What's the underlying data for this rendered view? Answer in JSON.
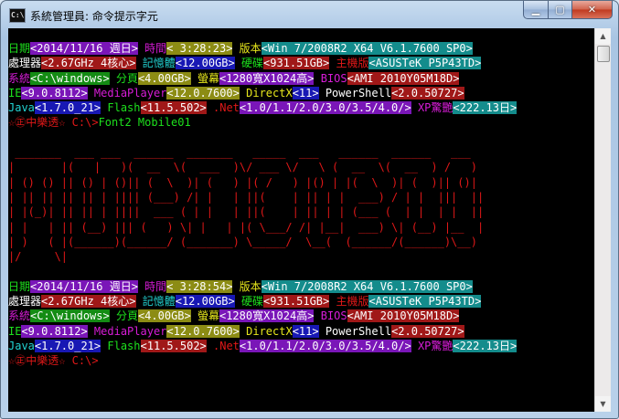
{
  "window": {
    "icon_text": "C:\\",
    "title": "系統管理員: 命令提示字元",
    "buttons": {
      "minimize": "▁",
      "maximize": "▢",
      "close": "✕"
    }
  },
  "colors": {
    "gray": "#c0c0c0",
    "white": "#ffffff",
    "green": "#1de01d",
    "cyan": "#22d3d3",
    "magenta": "#d81cd8",
    "red": "#e01818",
    "yellow": "#e6e61c",
    "bg_purple": "#7a16b8",
    "bg_olive": "#8c8c14",
    "bg_darkred": "#a01818",
    "bg_blue": "#1818b4",
    "bg_teal": "#148c8c",
    "bg_gray": "#808080",
    "bg_darkgreen": "#148c14"
  },
  "info_block_1": [
    [
      {
        "t": "日期",
        "fg": "green"
      },
      {
        "t": "<2014/11/16 週日>",
        "fg": "white",
        "bg": "bg_purple"
      },
      {
        "t": " 時間",
        "fg": "magenta"
      },
      {
        "t": "< 3:28:23>",
        "fg": "white",
        "bg": "bg_olive"
      },
      {
        "t": " 版本",
        "fg": "yellow"
      },
      {
        "t": "<Win 7/2008R2 X64 V6.1.7600 SP0>",
        "fg": "white",
        "bg": "bg_teal"
      }
    ],
    [
      {
        "t": "處理器",
        "fg": "white"
      },
      {
        "t": "<2.67GHz 4核心>",
        "fg": "white",
        "bg": "bg_darkred"
      },
      {
        "t": " 記憶體",
        "fg": "cyan"
      },
      {
        "t": "<12.00GB>",
        "fg": "white",
        "bg": "bg_blue"
      },
      {
        "t": " 硬碟",
        "fg": "green"
      },
      {
        "t": "<931.51GB>",
        "fg": "white",
        "bg": "bg_darkred"
      },
      {
        "t": " 主機版",
        "fg": "red"
      },
      {
        "t": "<ASUSTeK P5P43TD>",
        "fg": "white",
        "bg": "bg_teal"
      }
    ],
    [
      {
        "t": "系統",
        "fg": "magenta"
      },
      {
        "t": "<C:\\windows>",
        "fg": "white",
        "bg": "bg_darkgreen"
      },
      {
        "t": " 分頁",
        "fg": "green"
      },
      {
        "t": "<4.00GB>",
        "fg": "white",
        "bg": "bg_olive"
      },
      {
        "t": " 螢幕",
        "fg": "yellow"
      },
      {
        "t": "<1280寬X1024高>",
        "fg": "white",
        "bg": "bg_purple"
      },
      {
        "t": " BIOS",
        "fg": "magenta"
      },
      {
        "t": "<AMI 2010Y05M18D>",
        "fg": "white",
        "bg": "bg_darkred"
      }
    ],
    [
      {
        "t": "IE",
        "fg": "green"
      },
      {
        "t": "<9.0.8112>",
        "fg": "white",
        "bg": "bg_purple"
      },
      {
        "t": " MediaPlayer",
        "fg": "magenta"
      },
      {
        "t": "<12.0.7600>",
        "fg": "white",
        "bg": "bg_olive"
      },
      {
        "t": " DirectX",
        "fg": "yellow"
      },
      {
        "t": "<11>",
        "fg": "white",
        "bg": "bg_blue"
      },
      {
        "t": " PowerShell",
        "fg": "white"
      },
      {
        "t": "<2.0.50727>",
        "fg": "white",
        "bg": "bg_darkred"
      }
    ],
    [
      {
        "t": "Java",
        "fg": "cyan"
      },
      {
        "t": "<1.7.0_21>",
        "fg": "white",
        "bg": "bg_blue"
      },
      {
        "t": " Flash",
        "fg": "green"
      },
      {
        "t": "<11.5.502>",
        "fg": "white",
        "bg": "bg_darkred"
      },
      {
        "t": " .Net",
        "fg": "red"
      },
      {
        "t": "<1.0/1.1/2.0/3.0/3.5/4.0/>",
        "fg": "white",
        "bg": "bg_purple"
      },
      {
        "t": " XP驚艷",
        "fg": "magenta"
      },
      {
        "t": "<222.13日>",
        "fg": "white",
        "bg": "bg_teal"
      }
    ]
  ],
  "prompt_1": {
    "prefix": "☆㊣中樂透☆ C:\\>",
    "command": "Font2 Mobile01"
  },
  "ascii_art": [
    "",
    " _______  ___ ___  ______  _______   _____  ___   ______  ______   ___",
    "|       |(   |   )(  __  \\(  ___  )\\/ ___ \\/   \\ (  __  \\(  __  ) /   )",
    "| () () || () | ()|| (  \\  )| (   ) |( /   ) |() | |(  \\  )| (  )|| ()|",
    "| || || || || | |||| (___) /| |   | ||(    | || | |  ___) / | |  |||  ||",
    "| |(_)| || || | ||||  ___ ( | |   | ||(    | || | | (___ (  | |  | |  ||",
    "| |   | || (__) ||| (   ) \\| |   | |( \\___/ /| |__|  ___) \\| (__) |__  |",
    "| )   ( |(______)(______/ (_______) \\_____/  \\__(  (______/(______)\\__)",
    "|/     \\|                                          "
  ],
  "info_block_2": [
    [
      {
        "t": "日期",
        "fg": "green"
      },
      {
        "t": "<2014/11/16 週日>",
        "fg": "white",
        "bg": "bg_purple"
      },
      {
        "t": " 時間",
        "fg": "magenta"
      },
      {
        "t": "< 3:28:54>",
        "fg": "white",
        "bg": "bg_olive"
      },
      {
        "t": " 版本",
        "fg": "yellow"
      },
      {
        "t": "<Win 7/2008R2 X64 V6.1.7600 SP0>",
        "fg": "white",
        "bg": "bg_teal"
      }
    ],
    [
      {
        "t": "處理器",
        "fg": "white"
      },
      {
        "t": "<2.67GHz 4核心>",
        "fg": "white",
        "bg": "bg_darkred"
      },
      {
        "t": " 記憶體",
        "fg": "cyan"
      },
      {
        "t": "<12.00GB>",
        "fg": "white",
        "bg": "bg_blue"
      },
      {
        "t": " 硬碟",
        "fg": "green"
      },
      {
        "t": "<931.51GB>",
        "fg": "white",
        "bg": "bg_darkred"
      },
      {
        "t": " 主機版",
        "fg": "red"
      },
      {
        "t": "<ASUSTeK P5P43TD>",
        "fg": "white",
        "bg": "bg_teal"
      }
    ],
    [
      {
        "t": "系統",
        "fg": "magenta"
      },
      {
        "t": "<C:\\windows>",
        "fg": "white",
        "bg": "bg_darkgreen"
      },
      {
        "t": " 分頁",
        "fg": "green"
      },
      {
        "t": "<4.00GB>",
        "fg": "white",
        "bg": "bg_olive"
      },
      {
        "t": " 螢幕",
        "fg": "yellow"
      },
      {
        "t": "<1280寬X1024高>",
        "fg": "white",
        "bg": "bg_purple"
      },
      {
        "t": " BIOS",
        "fg": "magenta"
      },
      {
        "t": "<AMI 2010Y05M18D>",
        "fg": "white",
        "bg": "bg_darkred"
      }
    ],
    [
      {
        "t": "IE",
        "fg": "green"
      },
      {
        "t": "<9.0.8112>",
        "fg": "white",
        "bg": "bg_purple"
      },
      {
        "t": " MediaPlayer",
        "fg": "magenta"
      },
      {
        "t": "<12.0.7600>",
        "fg": "white",
        "bg": "bg_olive"
      },
      {
        "t": " DirectX",
        "fg": "yellow"
      },
      {
        "t": "<11>",
        "fg": "white",
        "bg": "bg_blue"
      },
      {
        "t": " PowerShell",
        "fg": "white"
      },
      {
        "t": "<2.0.50727>",
        "fg": "white",
        "bg": "bg_darkred"
      }
    ],
    [
      {
        "t": "Java",
        "fg": "cyan"
      },
      {
        "t": "<1.7.0_21>",
        "fg": "white",
        "bg": "bg_blue"
      },
      {
        "t": " Flash",
        "fg": "green"
      },
      {
        "t": "<11.5.502>",
        "fg": "white",
        "bg": "bg_darkred"
      },
      {
        "t": " .Net",
        "fg": "red"
      },
      {
        "t": "<1.0/1.1/2.0/3.0/3.5/4.0/>",
        "fg": "white",
        "bg": "bg_purple"
      },
      {
        "t": " XP驚艷",
        "fg": "magenta"
      },
      {
        "t": "<222.13日>",
        "fg": "white",
        "bg": "bg_teal"
      }
    ]
  ],
  "prompt_2": {
    "prefix": "☆㊣中樂透☆ C:\\>",
    "command": ""
  },
  "scrollbar": {
    "up": "▲",
    "down": "▼"
  }
}
